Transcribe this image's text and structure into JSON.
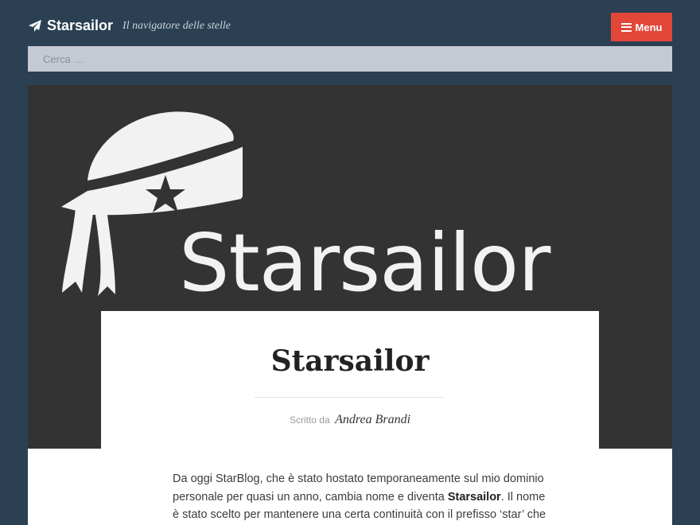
{
  "header": {
    "site_title": "Starsailor",
    "tagline": "Il navigatore delle stelle",
    "menu_label": "Menu",
    "logo_icon": "paper-plane-icon",
    "menu_icon": "hamburger-icon"
  },
  "search": {
    "placeholder": "Cerca …"
  },
  "hero": {
    "logo_text": "Starsailor",
    "logo_icon": "sailor-hat-star-icon"
  },
  "post": {
    "title": "Starsailor",
    "byline_label": "Scritto da",
    "author": "Andrea Brandi",
    "body_before": "Da oggi StarBlog, che è stato hostato temporaneamente sul mio dominio personale per quasi un anno, cambia nome e diventa ",
    "body_bold": "Starsailor",
    "body_after": ". Il nome è stato scelto per mantenere una certa continuità con il prefisso ‘star’ che mi"
  },
  "colors": {
    "background": "#2b4052",
    "menu_button": "#e2473a",
    "hero_bg": "#333333",
    "search_bg": "#c5c9d3"
  }
}
